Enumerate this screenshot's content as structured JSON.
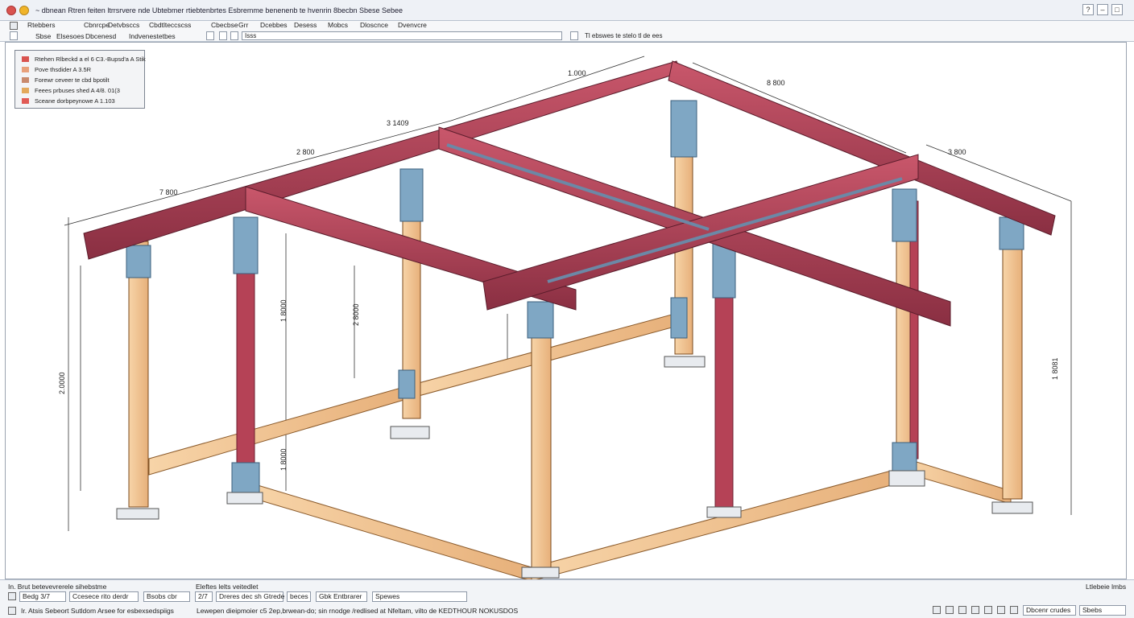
{
  "window": {
    "title": "~ dbnean Rtren feiten ltrrsrvere nde Ubtebmer rtiebtenbrtes Esbremme benenenb te hvenrin 8becbn Sbese Sebee"
  },
  "menu": [
    "Rtebbers",
    "Cbnrcpe",
    "Detvbsccs",
    "Cbdtlteccscss",
    "Cbecbse",
    "Grr",
    "Dcebbes",
    "Desess",
    "Mobcs",
    "Dloscnce",
    "Dvenvcre"
  ],
  "toolbar": {
    "items": [
      "Sbse",
      "Elsesoes",
      "Dbcenesd",
      "Indvenestetbes"
    ],
    "search_value": "Isss",
    "right_text": "Tl ebswes te stelo tl de ees"
  },
  "legend": {
    "items": [
      {
        "label": "Rtehen Rlbeckd a el 6 C3.-Bupsd'a A Stik",
        "color": "#d9534f"
      },
      {
        "label": "Pove thsdider A 3.5R",
        "color": "#e8a07a"
      },
      {
        "label": "Forewr ceveer te cbd bpotilt",
        "color": "#c98a6c"
      },
      {
        "label": "Feees prbuses shed A 4/8. 01(3",
        "color": "#e3a95c"
      },
      {
        "label": "Sceane dorbpeynowe A 1.103",
        "color": "#e15a55"
      }
    ]
  },
  "dimensions": {
    "top_front": "7 800",
    "top_mid": "2 800",
    "top_left_back": "3 1409",
    "top_back": "1.000",
    "top_right_back": "8 800",
    "right_edge": "3 800",
    "height_left": "2.0000",
    "height_mid1": "1 8000",
    "height_mid2": "2 8000",
    "height_low": "1 8000",
    "height_right": "1 8081"
  },
  "status": {
    "row1_left": "In. Brut betevevrerele sihebstme",
    "row1_mid": "Eleftes lelts veitedlet",
    "row1_right": "Ltlebeie lmbs",
    "fields": [
      "Bedg 3/7",
      "Ccesece rito derdr",
      "Bsobs cbr",
      "2/7",
      "Dreres dec sh Gtrede",
      "beces",
      "Gbk Entbrarer",
      "Spewes"
    ],
    "row2_left": "Ir. Atsis Sebeort Sutldom Arsee for esbexsedspiigs",
    "row2_mid": "Lewepen dieipmoier c5 2ep,brwean-do; sin rnodge /redlised at Nfeltam, vilto de KEDTHOUR NOKUSDOS",
    "row2_right_fields": [
      "Dbcenr crudes",
      "Sbebs"
    ]
  },
  "colors": {
    "beam": "#b84a5e",
    "beam_dark": "#8a2f42",
    "column_wood": "#f2c79a",
    "column_red": "#b54256",
    "connector": "#7fa7c4",
    "accent": "#2b5797"
  }
}
